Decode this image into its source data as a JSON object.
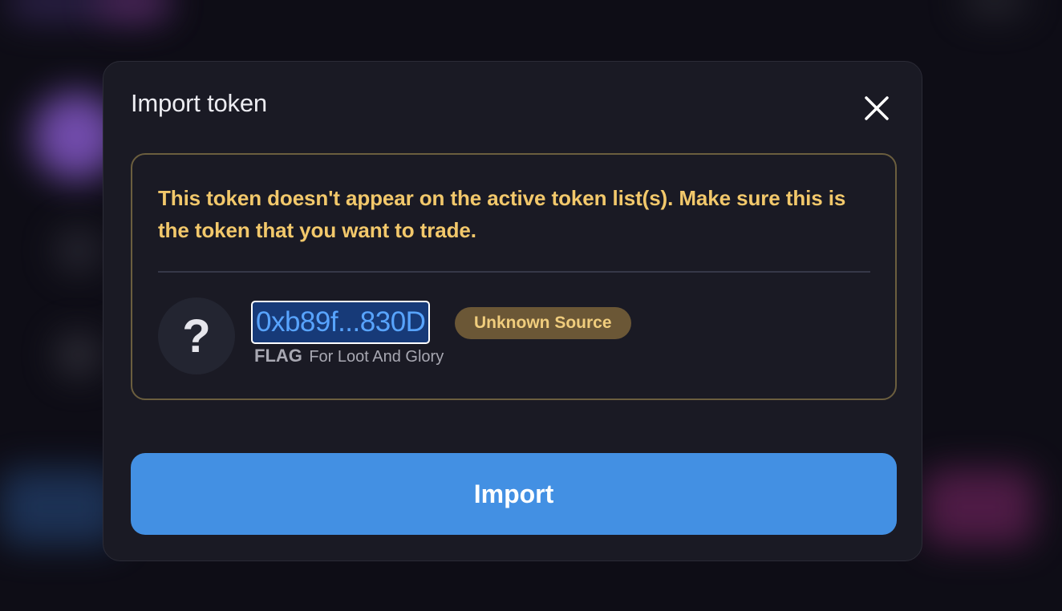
{
  "modal": {
    "title": "Import token",
    "close_icon": "close-icon"
  },
  "warning": {
    "message": "This token doesn't appear on the active token list(s). Make sure this is the token that you want to trade.",
    "border_color": "#6b5e3e",
    "text_color": "#f2c86b"
  },
  "token": {
    "icon_glyph": "?",
    "address": "0xb89f...830D",
    "badge": "Unknown Source",
    "symbol": "FLAG",
    "name": "For Loot And Glory"
  },
  "import_button": {
    "label": "Import",
    "color": "#4390e3"
  }
}
